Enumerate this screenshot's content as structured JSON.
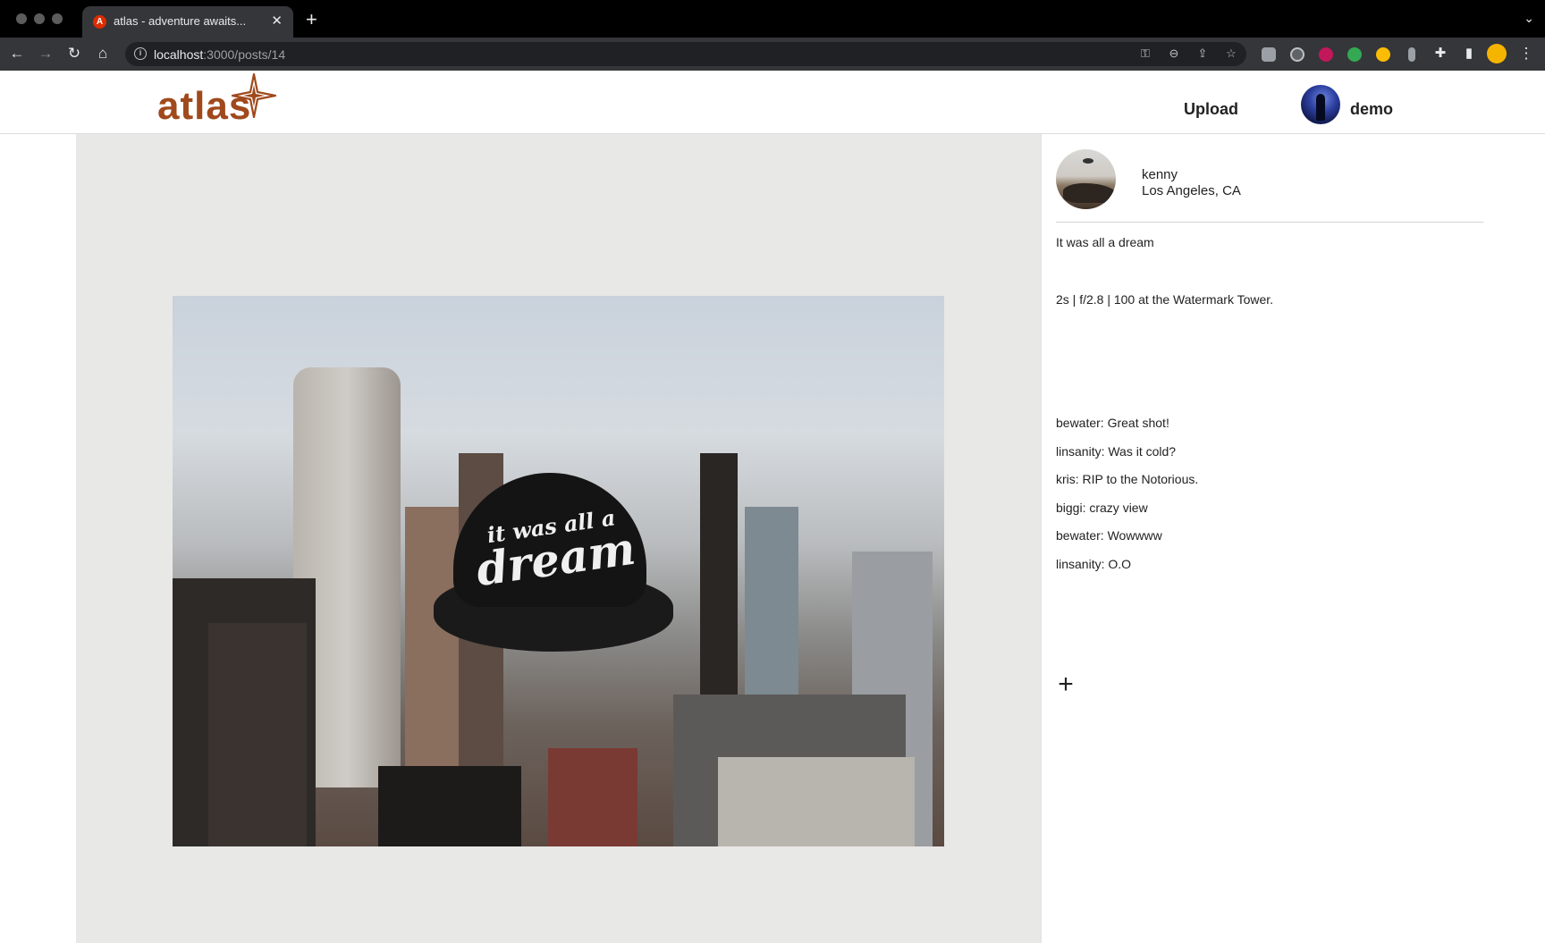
{
  "browser": {
    "tab_title": "atlas - adventure awaits...",
    "tab_favicon_letter": "A",
    "url_host": "localhost",
    "url_path": ":3000/posts/14"
  },
  "header": {
    "logo": "atlas",
    "upload_label": "Upload",
    "user_name": "demo"
  },
  "post": {
    "author": "kenny",
    "location": "Los Angeles, CA",
    "caption": "It was all a dream",
    "exif": "2s | f/2.8 | 100 at the Watermark Tower.",
    "hat_text_small": "it was all a",
    "hat_text_big": "dream",
    "comments": [
      "bewater: Great shot!",
      "linsanity: Was it cold?",
      "kris: RIP to the Notorious.",
      "biggi: crazy view",
      "bewater: Wowwww",
      "linsanity: O.O"
    ],
    "add_comment_icon": "plus-icon"
  },
  "colors": {
    "brand": "#a0491d",
    "stage_bg": "#e8e8e6",
    "chrome_bg": "#35363a"
  }
}
